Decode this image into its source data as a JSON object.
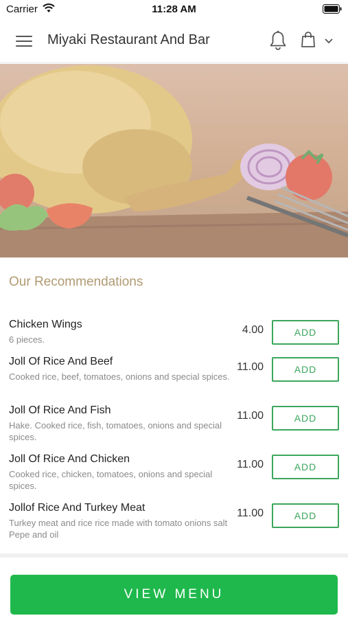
{
  "status_bar": {
    "carrier": "Carrier",
    "time": "11:28 AM"
  },
  "header": {
    "title": "Miyaki Restaurant And Bar",
    "icons": [
      "hamburger-menu-icon",
      "bell-icon",
      "shopping-bag-icon",
      "chevron-down-icon"
    ]
  },
  "hero": {
    "image": "roast-chicken-with-tomatoes-and-onion"
  },
  "recommendations": {
    "title": "Our Recommendations",
    "add_label": "ADD",
    "items": [
      {
        "name": "Chicken Wings",
        "description": "6 pieces.",
        "price": "4.00"
      },
      {
        "name": "Joll Of Rice And Beef",
        "description": "Cooked rice, beef, tomatoes, onions and special spices.",
        "price": "11.00"
      },
      {
        "name": "Joll Of Rice And Fish",
        "description": "Hake. Cooked rice, fish, tomatoes, onions and special spices.",
        "price": "11.00"
      },
      {
        "name": "Joll Of Rice And Chicken",
        "description": "Cooked rice, chicken, tomatoes, onions and special spices.",
        "price": "11.00"
      },
      {
        "name": "Jollof Rice And Turkey Meat",
        "description": "Turkey meat and rice rice made with tomato onions salt Pepe and oil",
        "price": "11.00"
      }
    ]
  },
  "footer": {
    "view_menu_label": "VIEW MENU"
  },
  "colors": {
    "accent_green": "#1fb84c",
    "add_green": "#3ba65c",
    "section_title": "#b09a72"
  }
}
